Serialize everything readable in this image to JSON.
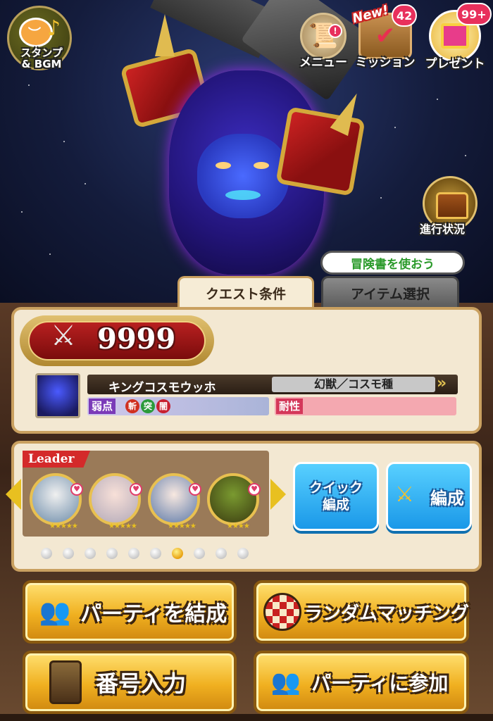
{
  "header": {
    "stamp_label": "スタンプ\n& BGM",
    "menu_label": "メニュー",
    "mission_label": "ミッション",
    "mission_new": "New!",
    "mission_count": "42",
    "present_label": "プレゼント",
    "present_count": "99+",
    "progress_label": "進行状況"
  },
  "tabs": {
    "hint": "冒険書を使おう",
    "quest": "クエスト条件",
    "item": "アイテム選択"
  },
  "quest": {
    "power": "9999",
    "enemy_name": "キングコスモウッホ",
    "enemy_type": "幻獣／コスモ種",
    "weak_label": "弱点",
    "weak_icons": [
      "斬",
      "突",
      "闇"
    ],
    "resist_label": "耐性"
  },
  "party": {
    "leader_label": "Leader",
    "page_count": 10,
    "active_page": 7,
    "quick_label": "クイック\n編成",
    "edit_label": "編成"
  },
  "actions": {
    "form_party": "パーティを結成",
    "random_match": "ランダムマッチング",
    "number_input": "番号入力",
    "join_party": "パーティに参加"
  },
  "colors": {
    "accent_red": "#b82020",
    "gold": "#f0b020",
    "blue_button": "#1a98e8",
    "badge_red": "#e8305c"
  }
}
